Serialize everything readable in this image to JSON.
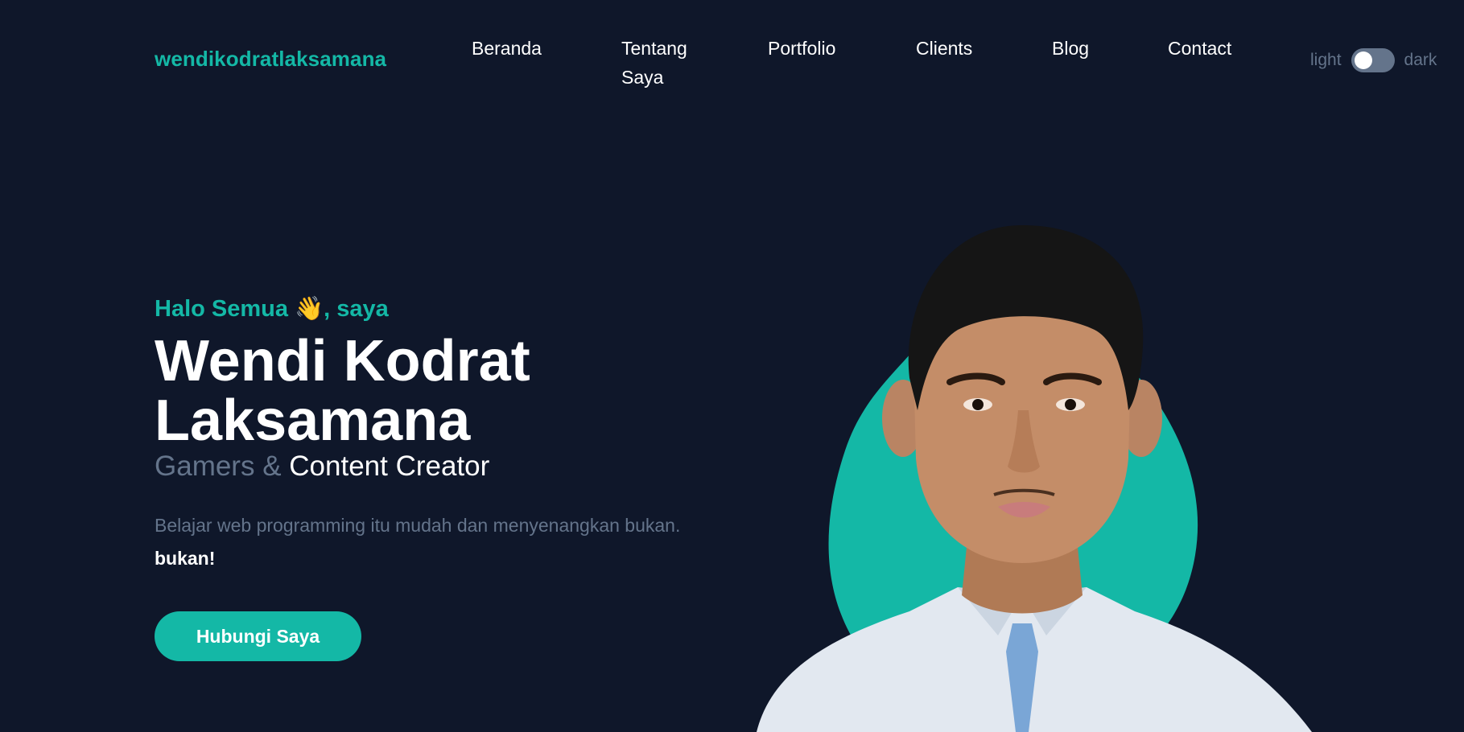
{
  "header": {
    "logo": "wendikodratlaksamana",
    "nav": [
      {
        "label": "Beranda"
      },
      {
        "label": "Tentang Saya"
      },
      {
        "label": "Portfolio"
      },
      {
        "label": "Clients"
      },
      {
        "label": "Blog"
      },
      {
        "label": "Contact"
      }
    ],
    "theme_toggle": {
      "light_label": "light",
      "dark_label": "dark"
    }
  },
  "hero": {
    "greeting_prefix": "Halo Semua",
    "greeting_emoji": "👋",
    "greeting_suffix": ", saya",
    "name": "Wendi Kodrat Laksamana",
    "role_prefix": "Gamers &",
    "role_main": "Content Creator",
    "description": "Belajar web programming itu mudah dan menyenangkan bukan.",
    "description_bold": "bukan!",
    "cta_label": "Hubungi Saya"
  },
  "colors": {
    "background": "#0f172a",
    "accent": "#14b8a6",
    "muted": "#64748b",
    "text": "#ffffff"
  }
}
